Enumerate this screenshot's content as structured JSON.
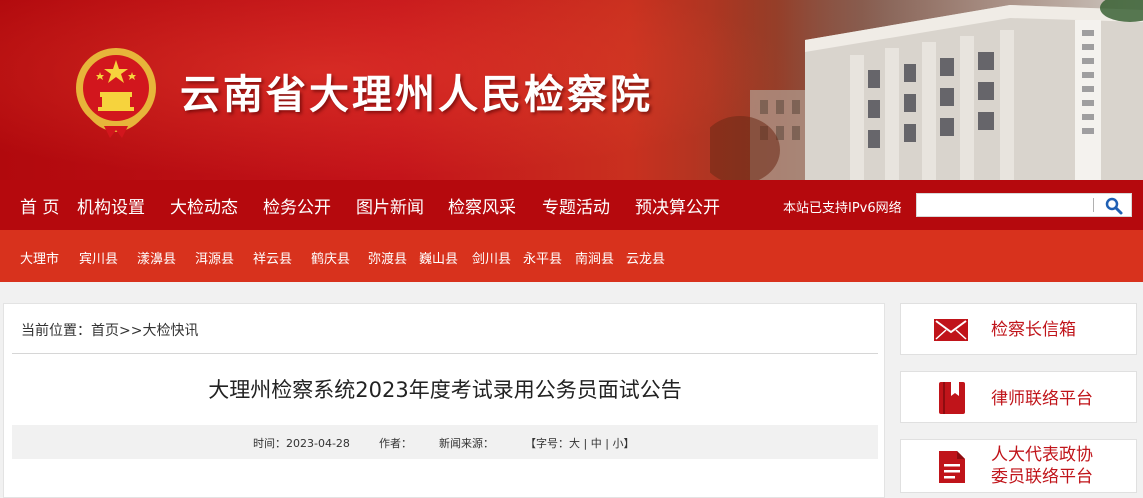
{
  "header": {
    "site_title": "云南省大理州人民检察院"
  },
  "main_nav": {
    "items": [
      {
        "label": "首 页"
      },
      {
        "label": "机构设置"
      },
      {
        "label": "大检动态"
      },
      {
        "label": "检务公开"
      },
      {
        "label": "图片新闻"
      },
      {
        "label": "检察风采"
      },
      {
        "label": "专题活动"
      },
      {
        "label": "预决算公开"
      }
    ],
    "ipv6_note": "本站已支持IPv6网络",
    "search": {
      "value": "",
      "placeholder": ""
    }
  },
  "county_nav": {
    "items": [
      {
        "label": "大理市"
      },
      {
        "label": "宾川县"
      },
      {
        "label": "漾濞县"
      },
      {
        "label": "洱源县"
      },
      {
        "label": "祥云县"
      },
      {
        "label": "鹤庆县"
      },
      {
        "label": "弥渡县"
      },
      {
        "label": "巍山县"
      },
      {
        "label": "剑川县"
      },
      {
        "label": "永平县"
      },
      {
        "label": "南涧县"
      },
      {
        "label": "云龙县"
      }
    ]
  },
  "breadcrumb": {
    "prefix": "当前位置：",
    "home": "首页",
    "sep": ">>",
    "current": "大检快讯"
  },
  "article": {
    "title": "大理州检察系统2023年度考试录用公务员面试公告",
    "time_label": "时间：",
    "time_value": "2023-04-28",
    "author_label": "作者：",
    "source_label": "新闻来源：",
    "font_size_open": "【字号：",
    "font_large": "大",
    "font_medium": "中",
    "font_small": "小",
    "font_sep": "|",
    "font_size_close": "】"
  },
  "side_links": [
    {
      "label": "检察长信箱",
      "icon": "envelope-icon"
    },
    {
      "label": "律师联络平台",
      "icon": "book-icon"
    },
    {
      "label_line1": "人大代表政协",
      "label_line2": "委员联络平台",
      "icon": "document-icon"
    }
  ],
  "colors": {
    "brand_red": "#b5090d",
    "county_bar": "#d8321d",
    "side_label": "#c0141a"
  }
}
